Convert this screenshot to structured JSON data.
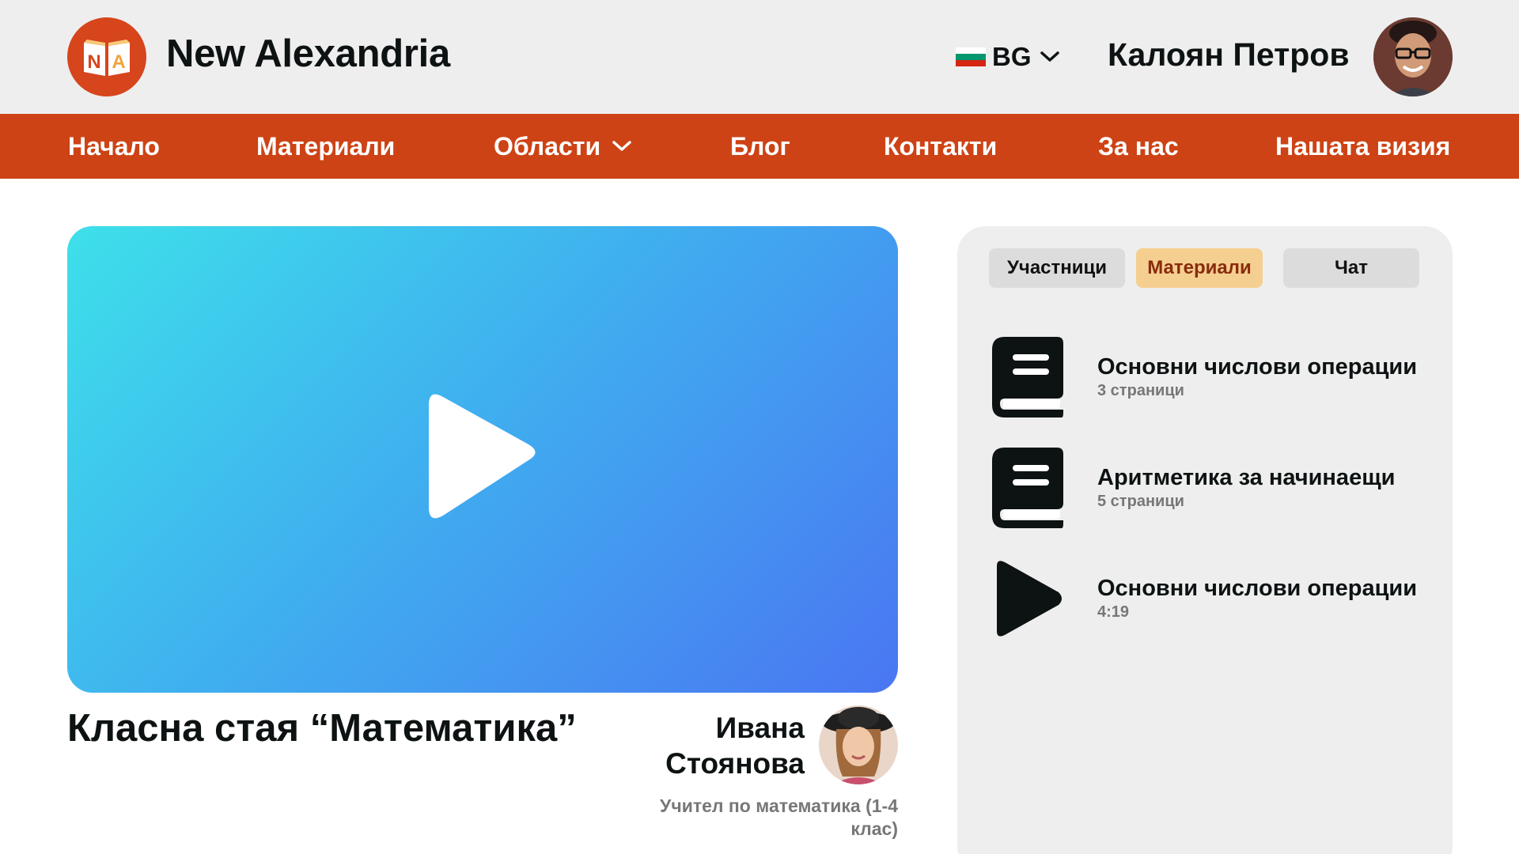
{
  "brand": {
    "name": "New Alexandria",
    "logo_letters": [
      "N",
      "A"
    ],
    "color": "#d6451c"
  },
  "header": {
    "language": {
      "code": "BG",
      "flag_colors": [
        "#ffffff",
        "#00966e",
        "#d62612"
      ]
    },
    "user_name": "Калоян Петров"
  },
  "nav": {
    "items": [
      {
        "label": "Начало"
      },
      {
        "label": "Материали"
      },
      {
        "label": "Области",
        "dropdown": true
      },
      {
        "label": "Блог"
      },
      {
        "label": "Контакти"
      },
      {
        "label": "За нас"
      },
      {
        "label": "Нашата визия"
      }
    ],
    "background": "#cd4315"
  },
  "classroom": {
    "title": "Класна стая “Математика”",
    "teacher": {
      "name": "Ивана Стоянова",
      "role": "Учител по математика (1-4 клас)"
    }
  },
  "panel": {
    "tabs": [
      {
        "label": "Участници",
        "active": false
      },
      {
        "label": "Материали",
        "active": true
      },
      {
        "label": "Чат",
        "active": false
      }
    ],
    "materials": [
      {
        "icon": "book-icon",
        "title": "Основни числови операции",
        "subtitle": "3 страници"
      },
      {
        "icon": "book-icon",
        "title": "Аритметика за начинаещи",
        "subtitle": "5 страници"
      },
      {
        "icon": "play-icon",
        "title": "Основни числови операции",
        "subtitle": "4:19"
      }
    ]
  }
}
